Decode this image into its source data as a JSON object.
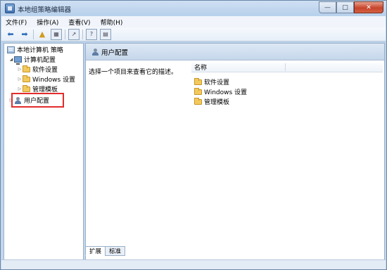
{
  "window": {
    "title": "本地组策略编辑器"
  },
  "menu": [
    "文件(F)",
    "操作(A)",
    "查看(V)",
    "帮助(H)"
  ],
  "toolbar_icons": [
    "back-arrow-icon",
    "forward-arrow-icon",
    "folder-up-icon",
    "show-hide-tree-icon",
    "export-icon",
    "help-icon",
    "properties-icon"
  ],
  "tree": {
    "root": "本地计算机 策略",
    "computer_config": "计算机配置",
    "computer_children": [
      "软件设置",
      "Windows 设置",
      "管理模板"
    ],
    "user_config": "用户配置"
  },
  "details": {
    "header": "用户配置",
    "description": "选择一个项目来查看它的描述。",
    "column_name": "名称",
    "items": [
      "软件设置",
      "Windows 设置",
      "管理模板"
    ]
  },
  "tabs": [
    "扩展",
    "标准"
  ],
  "highlight_color": "#e32b2b"
}
